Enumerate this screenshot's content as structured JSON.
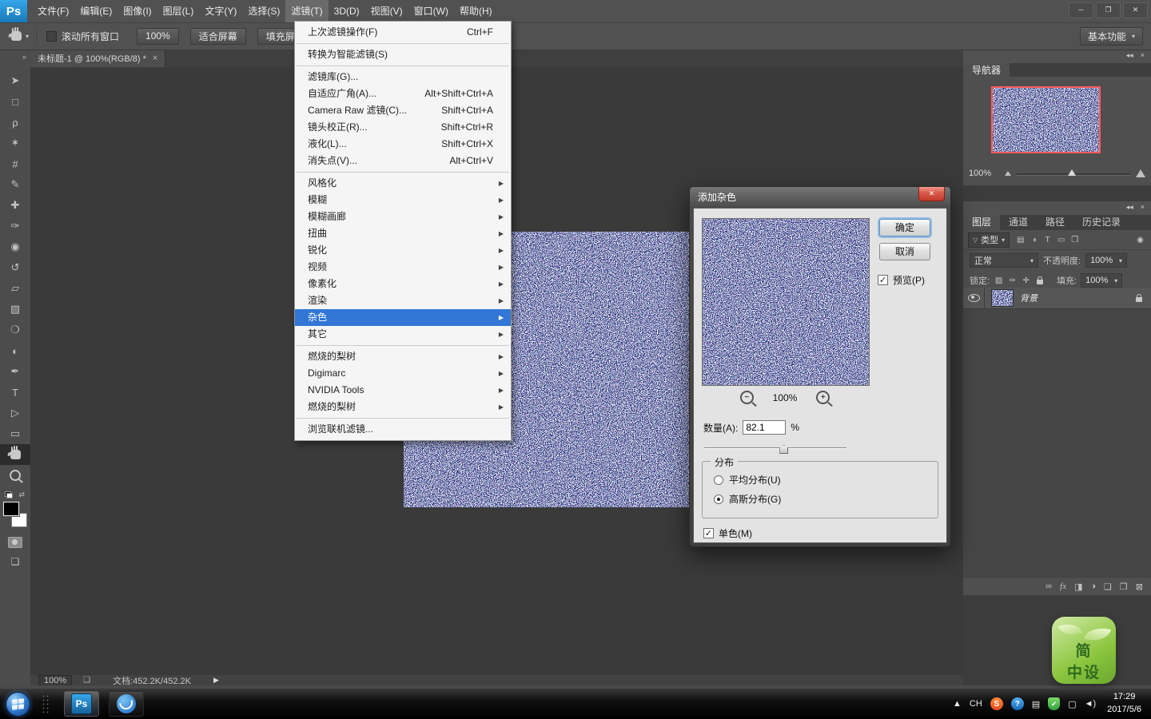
{
  "colors": {
    "menu_highlight": "#3277d6",
    "noise_base": "#232e75",
    "logo_blue": "#2ea3e6",
    "navigator_frame": "#ff5a5a"
  },
  "icons": {
    "submenu_arrow": "▶",
    "dropdown_arrow": "▾",
    "checkmark": "✓",
    "close": "✕",
    "minimize": "─",
    "restore": "❐",
    "tab_close": "×",
    "status_arrow": "▶",
    "status_icon": "❏",
    "collapse_panels": "◂◂",
    "panel_close": "×",
    "dock_collapse": "»",
    "swap": "⇄",
    "minus": "−",
    "plus": "+",
    "funnel": "▽",
    "screen_mode": "❏"
  },
  "app": {
    "logo": "Ps",
    "menus": [
      "文件(F)",
      "编辑(E)",
      "图像(I)",
      "图层(L)",
      "文字(Y)",
      "选择(S)",
      "滤镜(T)",
      "3D(D)",
      "视图(V)",
      "窗口(W)",
      "帮助(H)"
    ],
    "active_menu": "滤镜(T)"
  },
  "options_bar": {
    "scroll_all": "滚动所有窗口",
    "btn_100": "100%",
    "btn_fit": "适合屏幕",
    "btn_fill": "填充屏幕",
    "workspace": "基本功能"
  },
  "document_tab": {
    "title": "未标题-1 @ 100%(RGB/8) *"
  },
  "tools": [
    {
      "name": "move-tool",
      "glyph": "➤"
    },
    {
      "name": "marquee-tool",
      "glyph": "□"
    },
    {
      "name": "lasso-tool",
      "glyph": "ρ"
    },
    {
      "name": "quick-selection-tool",
      "glyph": "✶"
    },
    {
      "name": "crop-tool",
      "glyph": "#"
    },
    {
      "name": "eyedropper-tool",
      "glyph": "✎"
    },
    {
      "name": "healing-brush-tool",
      "glyph": "✚"
    },
    {
      "name": "brush-tool",
      "glyph": "✑"
    },
    {
      "name": "clone-stamp-tool",
      "glyph": "◉"
    },
    {
      "name": "history-brush-tool",
      "glyph": "↺"
    },
    {
      "name": "eraser-tool",
      "glyph": "▱"
    },
    {
      "name": "gradient-tool",
      "glyph": "▧"
    },
    {
      "name": "blur-tool",
      "glyph": "❍"
    },
    {
      "name": "dodge-tool",
      "glyph": "◐"
    },
    {
      "name": "pen-tool",
      "glyph": "✒"
    },
    {
      "name": "type-tool",
      "glyph": "T"
    },
    {
      "name": "path-selection-tool",
      "glyph": "▷"
    },
    {
      "name": "shape-tool",
      "glyph": "▭"
    },
    {
      "name": "hand-tool",
      "glyph": "@hand",
      "selected": true
    },
    {
      "name": "zoom-tool",
      "glyph": "@zoom"
    }
  ],
  "filter_menu": [
    {
      "label": "上次滤镜操作(F)",
      "shortcut": "Ctrl+F"
    },
    {
      "sep": true
    },
    {
      "label": "转换为智能滤镜(S)"
    },
    {
      "sep": true
    },
    {
      "label": "滤镜库(G)..."
    },
    {
      "label": "自适应广角(A)...",
      "shortcut": "Alt+Shift+Ctrl+A"
    },
    {
      "label": "Camera Raw 滤镜(C)...",
      "shortcut": "Shift+Ctrl+A"
    },
    {
      "label": "镜头校正(R)...",
      "shortcut": "Shift+Ctrl+R"
    },
    {
      "label": "液化(L)...",
      "shortcut": "Shift+Ctrl+X"
    },
    {
      "label": "消失点(V)...",
      "shortcut": "Alt+Ctrl+V"
    },
    {
      "sep": true
    },
    {
      "label": "风格化",
      "submenu": true
    },
    {
      "label": "模糊",
      "submenu": true
    },
    {
      "label": "模糊画廊",
      "submenu": true
    },
    {
      "label": "扭曲",
      "submenu": true
    },
    {
      "label": "锐化",
      "submenu": true
    },
    {
      "label": "视频",
      "submenu": true
    },
    {
      "label": "像素化",
      "submenu": true
    },
    {
      "label": "渲染",
      "submenu": true
    },
    {
      "label": "杂色",
      "submenu": true,
      "hl": true
    },
    {
      "label": "其它",
      "submenu": true
    },
    {
      "sep": true
    },
    {
      "label": "燃烧的梨树",
      "submenu": true
    },
    {
      "label": "Digimarc",
      "submenu": true
    },
    {
      "label": "NVIDIA Tools",
      "submenu": true
    },
    {
      "label": "燃烧的梨树",
      "submenu": true
    },
    {
      "sep": true
    },
    {
      "label": "浏览联机滤镜..."
    }
  ],
  "status_bar": {
    "zoom": "100%",
    "doc": "文档:452.2K/452.2K"
  },
  "navigator": {
    "tab": "导航器",
    "zoom": "100%"
  },
  "panels": {
    "tabs": [
      "图层",
      "通道",
      "路径",
      "历史记录"
    ],
    "active_tab": "图层",
    "filter_label": "类型",
    "filter_icons": [
      {
        "name": "filter-pixel-layers-icon",
        "glyph": "▤"
      },
      {
        "name": "filter-adjustment-layers-icon",
        "glyph": "◑"
      },
      {
        "name": "filter-type-layers-icon",
        "glyph": "T"
      },
      {
        "name": "filter-shape-layers-icon",
        "glyph": "▭"
      },
      {
        "name": "filter-smart-objects-icon",
        "glyph": "❒"
      },
      {
        "name": "filter-toggle-icon",
        "glyph": "◉"
      }
    ],
    "blend_mode": "正常",
    "opacity_label": "不透明度:",
    "opacity_value": "100%",
    "lock_label": "锁定:",
    "lock_icons": [
      {
        "name": "lock-transparency-icon",
        "glyph": "▨"
      },
      {
        "name": "lock-pixels-icon",
        "glyph": "✑"
      },
      {
        "name": "lock-position-icon",
        "glyph": "✛"
      },
      {
        "name": "lock-all-icon",
        "glyph": "@lock"
      }
    ],
    "fill_label": "填充:",
    "fill_value": "100%",
    "layer_name": "背景",
    "bottom_icons": [
      {
        "name": "link-layers-icon",
        "glyph": "∞"
      },
      {
        "name": "layer-style-icon",
        "glyph": "fx"
      },
      {
        "name": "layer-mask-icon",
        "glyph": "◨"
      },
      {
        "name": "adjustment-layer-icon",
        "glyph": "◑"
      },
      {
        "name": "layer-group-icon",
        "glyph": "❏"
      },
      {
        "name": "new-layer-icon",
        "glyph": "❐"
      },
      {
        "name": "delete-layer-icon",
        "glyph": "⊠"
      }
    ]
  },
  "dialog": {
    "title": "添加杂色",
    "ok": "确定",
    "cancel": "取消",
    "preview": "预览(P)",
    "zoom": "100%",
    "amount_label": "数量(A):",
    "amount_value": "82.1",
    "percent": "%",
    "group_label": "分布",
    "radio_uniform": "平均分布(U)",
    "radio_gaussian": "高斯分布(G)",
    "monochrome": "单色(M)"
  },
  "taskbar": {
    "tray": [
      {
        "name": "tray-expand-icon",
        "glyph": "▲",
        "cls": "plain"
      },
      {
        "name": "ime-language-indicator",
        "glyph": "CH",
        "cls": "plain"
      },
      {
        "name": "sogou-ime-icon",
        "glyph": "S",
        "cls": "sogou"
      },
      {
        "name": "help-tray-icon",
        "glyph": "?",
        "cls": "blue-circle"
      },
      {
        "name": "ime-toolbar-icon",
        "glyph": "▤",
        "cls": "plain"
      },
      {
        "name": "security-shield-icon",
        "glyph": "✔",
        "cls": "shield"
      },
      {
        "name": "display-tray-icon",
        "glyph": "▢",
        "cls": "plain"
      },
      {
        "name": "volume-tray-icon",
        "glyph": "◄)",
        "cls": "plain"
      }
    ],
    "time": "17:29",
    "date": "2017/5/6"
  },
  "badge": {
    "line1": "简",
    "line2": "中设"
  }
}
